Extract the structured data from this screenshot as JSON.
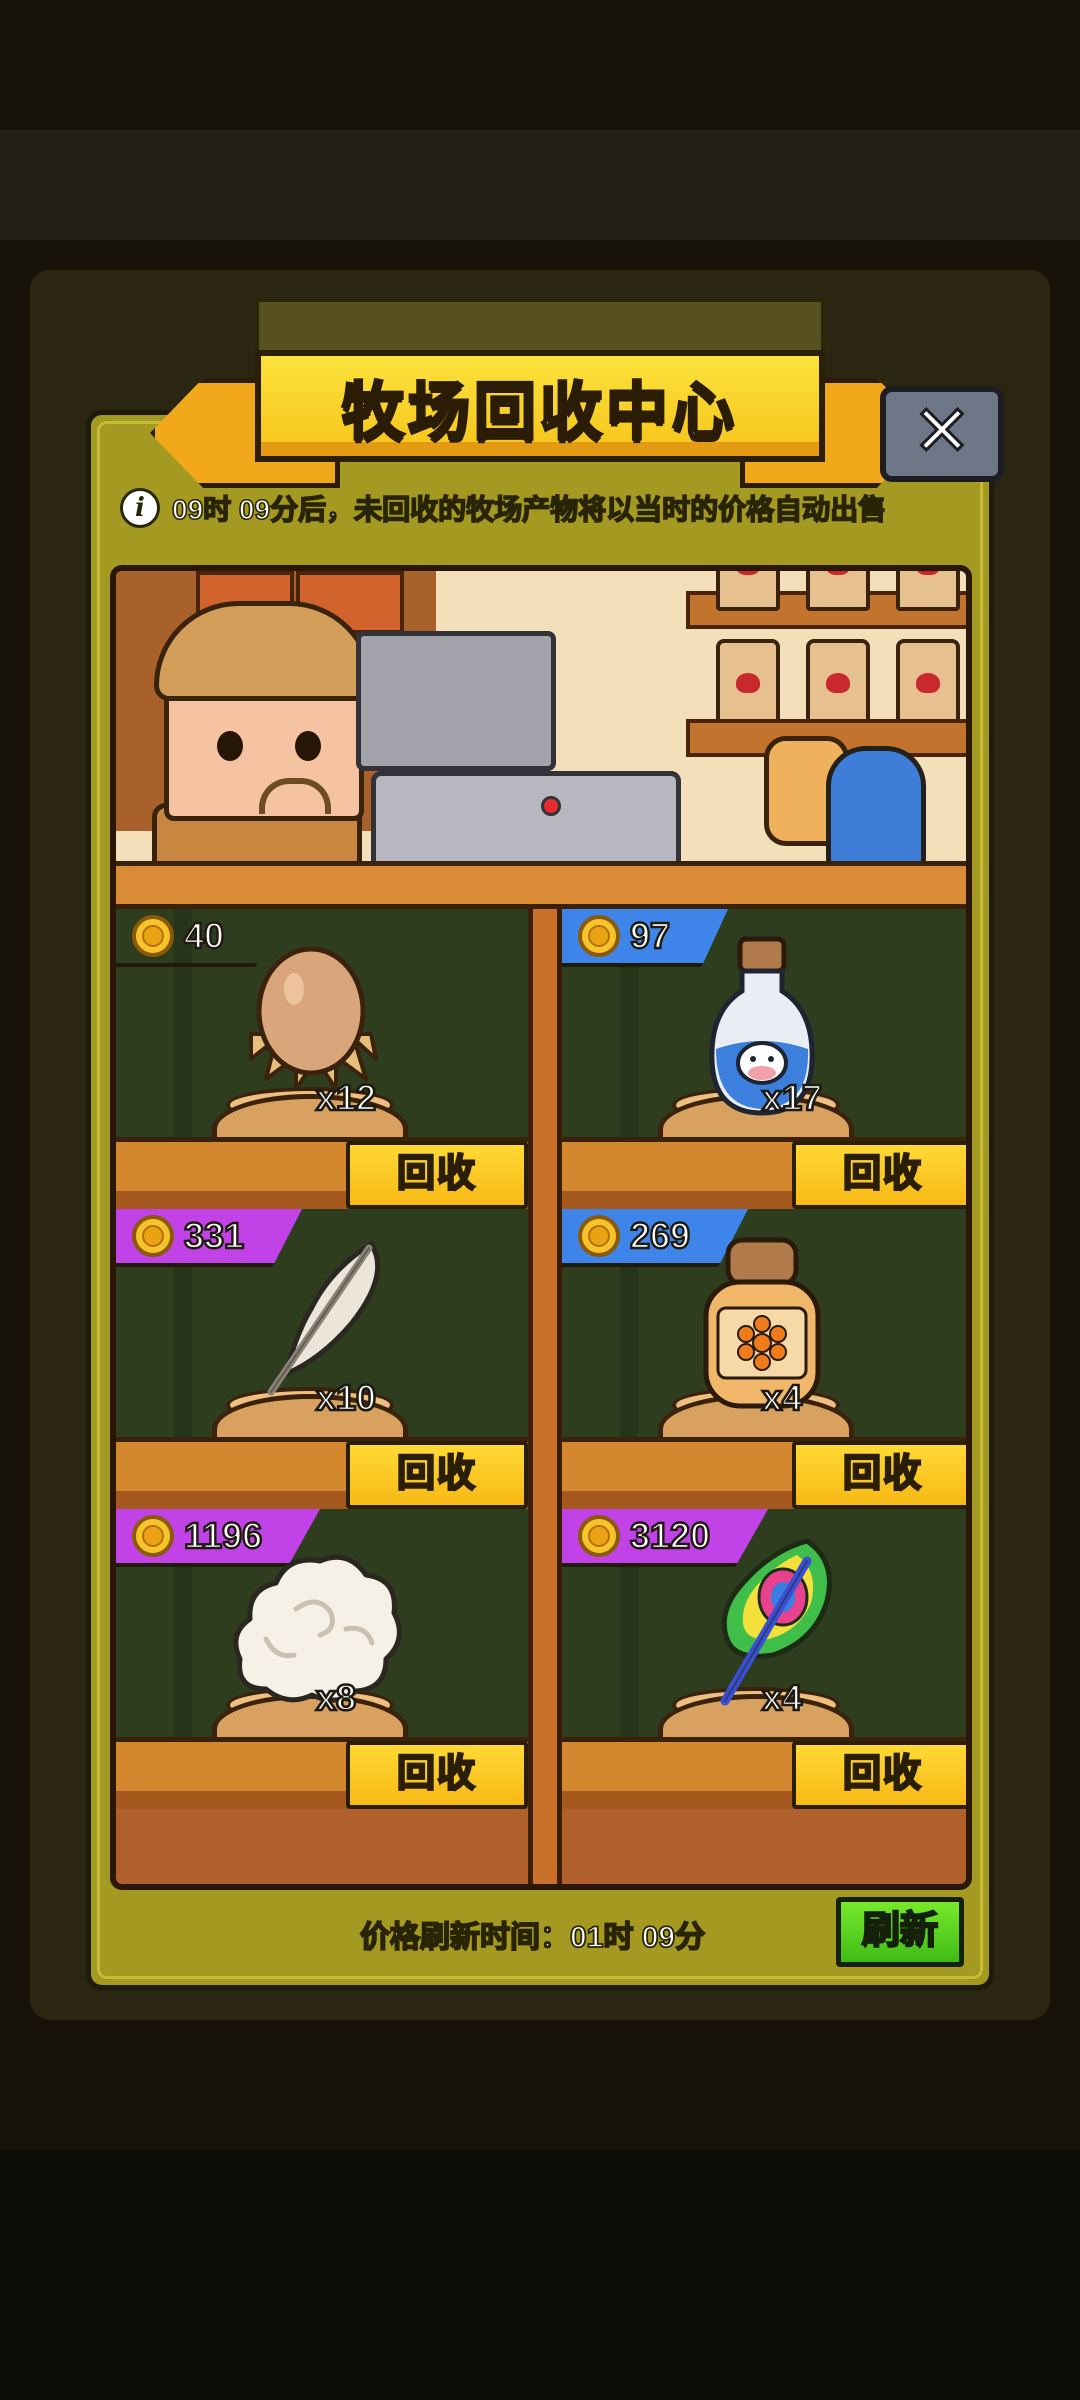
{
  "dialog": {
    "title": "牧场回收中心",
    "close_label": "✕",
    "notice": "09时 09分后，未回收的牧场产物将以当时的价格自动出售",
    "info_icon": "info-icon"
  },
  "items": [
    {
      "name": "egg",
      "price": "40",
      "tag_color": "white",
      "qty": "x12",
      "button": "回收"
    },
    {
      "name": "milk",
      "price": "97",
      "tag_color": "blue",
      "qty": "x17",
      "button": "回收"
    },
    {
      "name": "feather",
      "price": "331",
      "tag_color": "purple",
      "qty": "x10",
      "button": "回收"
    },
    {
      "name": "honey",
      "price": "269",
      "tag_color": "blue",
      "qty": "x4",
      "button": "回收"
    },
    {
      "name": "wool",
      "price": "1196",
      "tag_color": "purple",
      "qty": "x8",
      "button": "回收"
    },
    {
      "name": "peacock-feather",
      "price": "3120",
      "tag_color": "purple",
      "qty": "x4",
      "button": "回收"
    }
  ],
  "footer": {
    "refresh_time": "价格刷新时间：01时 09分",
    "refresh_button": "刷新"
  },
  "colors": {
    "panel": "#a49a22",
    "banner": "#f6c41a",
    "recycle_button": "#f7b915",
    "refresh_button": "#3fbc16",
    "tag_white": "#f1f1f1",
    "tag_blue": "#3f84e8",
    "tag_purple": "#c143e8"
  }
}
